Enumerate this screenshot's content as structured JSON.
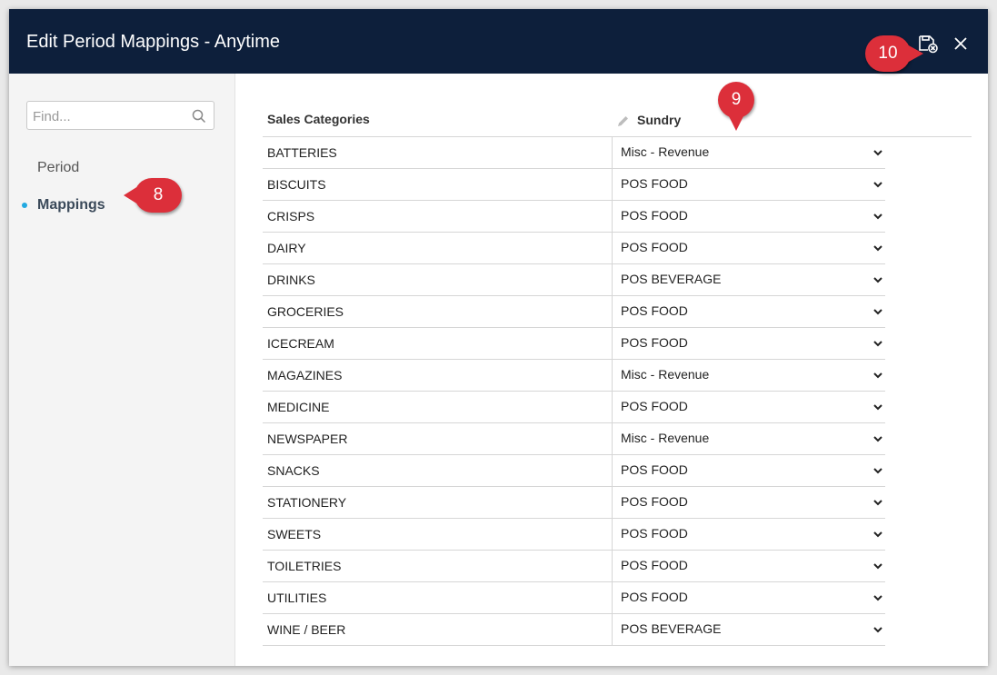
{
  "dialog": {
    "title": "Edit Period Mappings - Anytime"
  },
  "sidebar": {
    "search_placeholder": "Find...",
    "items": [
      {
        "label": "Period",
        "active": false
      },
      {
        "label": "Mappings",
        "active": true
      }
    ]
  },
  "callouts": {
    "c8": "8",
    "c9": "9",
    "c10": "10"
  },
  "table": {
    "headers": {
      "category": "Sales Categories",
      "sundry": "Sundry"
    },
    "rows": [
      {
        "category": "BATTERIES",
        "mapping": "Misc - Revenue"
      },
      {
        "category": "BISCUITS",
        "mapping": "POS FOOD"
      },
      {
        "category": "CRISPS",
        "mapping": "POS FOOD"
      },
      {
        "category": "DAIRY",
        "mapping": "POS FOOD"
      },
      {
        "category": "DRINKS",
        "mapping": "POS BEVERAGE"
      },
      {
        "category": "GROCERIES",
        "mapping": "POS FOOD"
      },
      {
        "category": "ICECREAM",
        "mapping": "POS FOOD"
      },
      {
        "category": "MAGAZINES",
        "mapping": "Misc - Revenue"
      },
      {
        "category": "MEDICINE",
        "mapping": "POS FOOD"
      },
      {
        "category": "NEWSPAPER",
        "mapping": "Misc - Revenue"
      },
      {
        "category": "SNACKS",
        "mapping": "POS FOOD"
      },
      {
        "category": "STATIONERY",
        "mapping": "POS FOOD"
      },
      {
        "category": "SWEETS",
        "mapping": "POS FOOD"
      },
      {
        "category": "TOILETRIES",
        "mapping": "POS FOOD"
      },
      {
        "category": "UTILITIES",
        "mapping": "POS FOOD"
      },
      {
        "category": "WINE / BEER",
        "mapping": "POS BEVERAGE"
      }
    ]
  },
  "colors": {
    "header_bg": "#0d1f3b",
    "accent": "#21a9e1",
    "callout": "#dc2f3a"
  },
  "icons": {
    "save": "save-cancel-icon",
    "close": "close-icon",
    "search": "search-icon",
    "edit": "pencil-icon",
    "dropdown": "chevron-down-icon"
  }
}
